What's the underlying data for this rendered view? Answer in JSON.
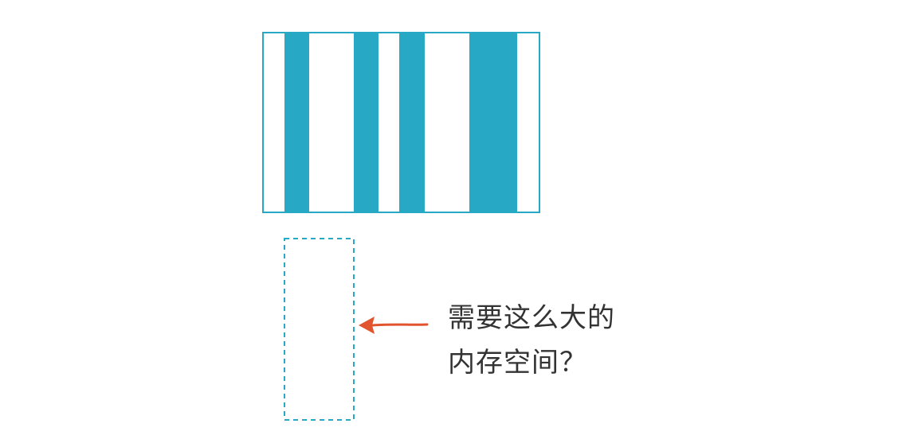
{
  "colors": {
    "block": "#27a8c5",
    "border": "#27a8c5",
    "dashed": "#27a8c5",
    "arrow": "#e1542e",
    "text": "#333333"
  },
  "memory_block": {
    "segments": [
      {
        "filled": false
      },
      {
        "filled": true
      },
      {
        "filled": false
      },
      {
        "filled": true
      },
      {
        "filled": false
      },
      {
        "filled": true
      },
      {
        "filled": false
      },
      {
        "filled": true
      },
      {
        "filled": false
      }
    ]
  },
  "annotation": {
    "line1": "需要这么大的",
    "line2": "内存空间？"
  }
}
